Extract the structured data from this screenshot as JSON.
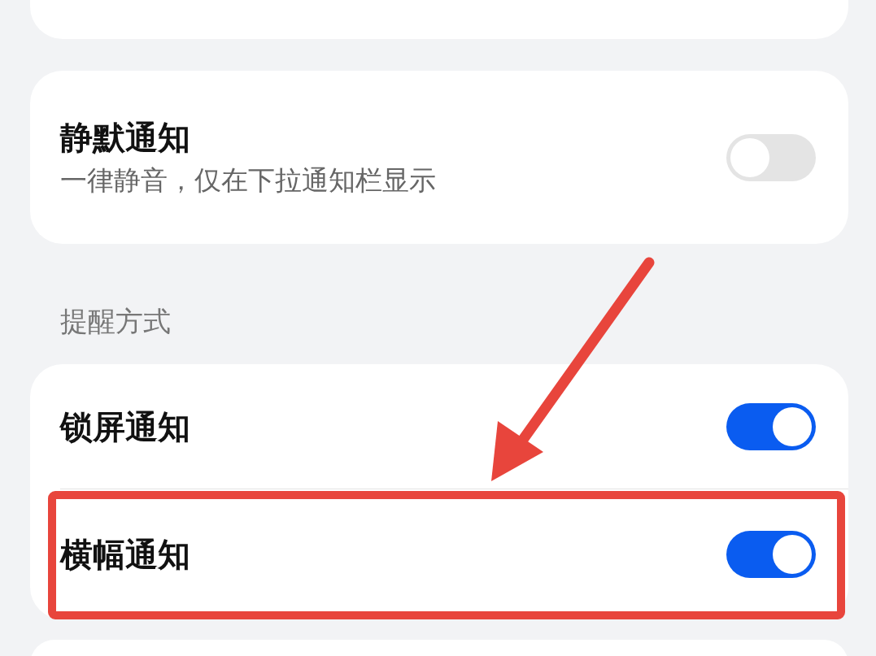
{
  "cards": [
    {
      "rows": [
        {
          "title": "静默通知",
          "subtitle": "一律静音，仅在下拉通知栏显示",
          "on": false
        }
      ]
    },
    {
      "label": "提醒方式",
      "rows": [
        {
          "title": "锁屏通知",
          "on": true
        },
        {
          "title": "横幅通知",
          "on": true
        }
      ]
    }
  ]
}
